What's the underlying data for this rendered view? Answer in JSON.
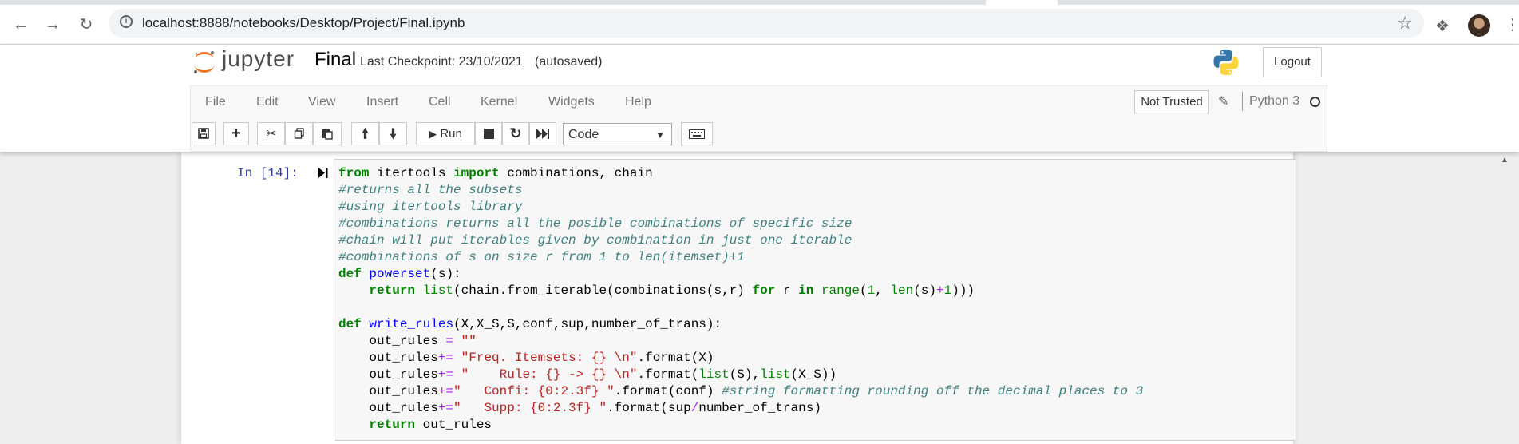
{
  "browser": {
    "url": "localhost:8888/notebooks/Desktop/Project/Final.ipynb"
  },
  "header": {
    "logo_text": "jupyter",
    "notebook_name": "Final",
    "checkpoint": "Last Checkpoint: 23/10/2021",
    "autosaved": "(autosaved)",
    "logout_label": "Logout"
  },
  "menubar": {
    "items": [
      "File",
      "Edit",
      "View",
      "Insert",
      "Cell",
      "Kernel",
      "Widgets",
      "Help"
    ],
    "trust_label": "Not Trusted",
    "kernel_name": "Python 3"
  },
  "toolbar": {
    "run_label": "Run",
    "cell_type": "Code"
  },
  "cell": {
    "prompt": "In [14]:",
    "lines": [
      "from itertools import combinations, chain",
      "#returns all the subsets",
      "#using itertools library",
      "#combinations returns all the posible combinations of specific size",
      "#chain will put iterables given by combination in just one iterable",
      "#combinations of s on size r from 1 to len(itemset)+1",
      "def powerset(s):",
      "    return list(chain.from_iterable(combinations(s,r) for r in range(1, len(s)+1)))",
      "",
      "def write_rules(X,X_S,S,conf,sup,number_of_trans):",
      "    out_rules = \"\"",
      "    out_rules+= \"Freq. Itemsets: {} \\n\".format(X)",
      "    out_rules+= \"    Rule: {} -> {} \\n\".format(list(S),list(X_S))",
      "    out_rules+=\"   Confi: {0:2.3f} \".format(conf) #string formatting rounding off the decimal places to 3",
      "    out_rules+=\"   Supp: {0:2.3f} \".format(sup/number_of_trans)",
      "    return out_rules"
    ]
  }
}
